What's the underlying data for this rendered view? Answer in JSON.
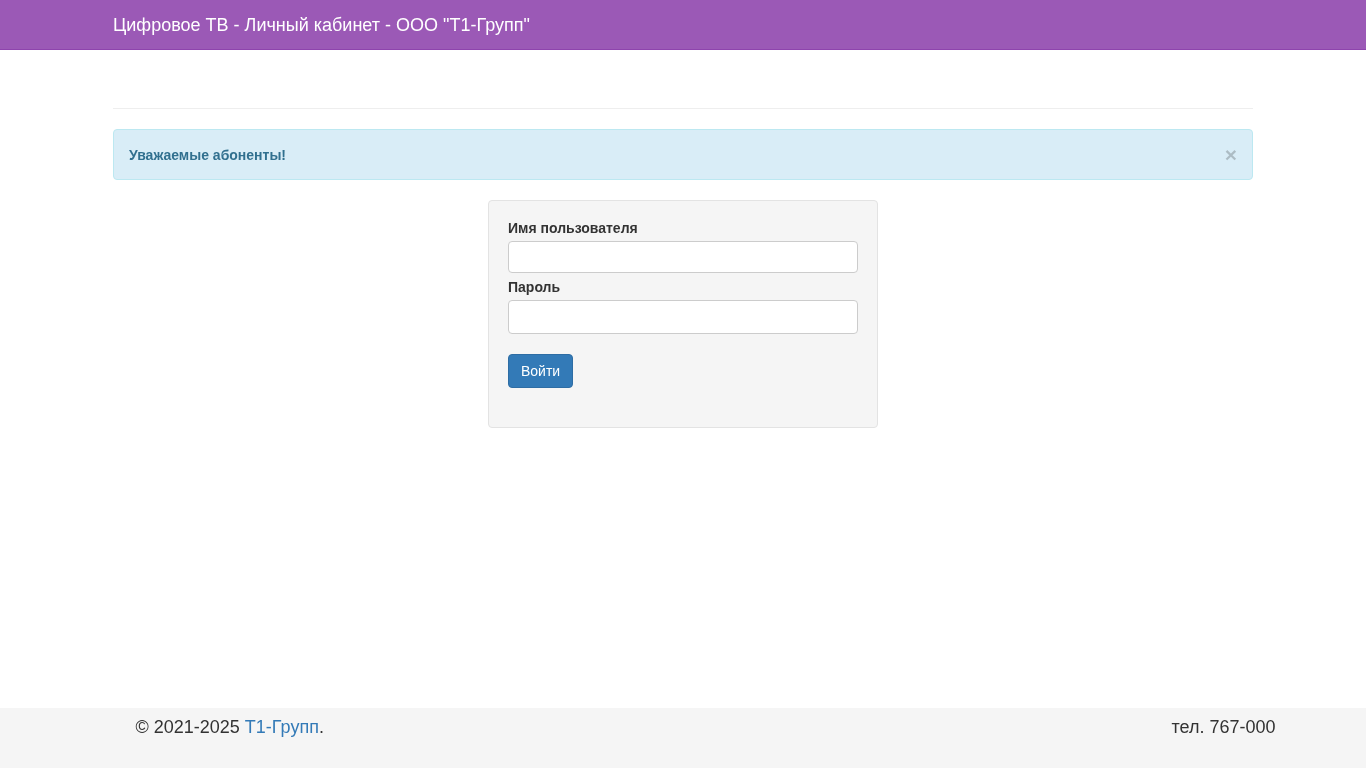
{
  "header": {
    "title": "Цифровое ТВ - Личный кабинет - ООО \"Т1-Групп\""
  },
  "alert": {
    "text": "Уважаемые абоненты!",
    "close": "×"
  },
  "login_form": {
    "fields": [
      {
        "label": "Имя пользователя",
        "kind": "text"
      },
      {
        "label": "Пароль",
        "kind": "password"
      }
    ],
    "button": "Войти"
  },
  "footer": {
    "copyright": "© 2021-2025",
    "link": "Т1-Групп",
    "suffix": ".",
    "phone": "тел. 767-000"
  }
}
